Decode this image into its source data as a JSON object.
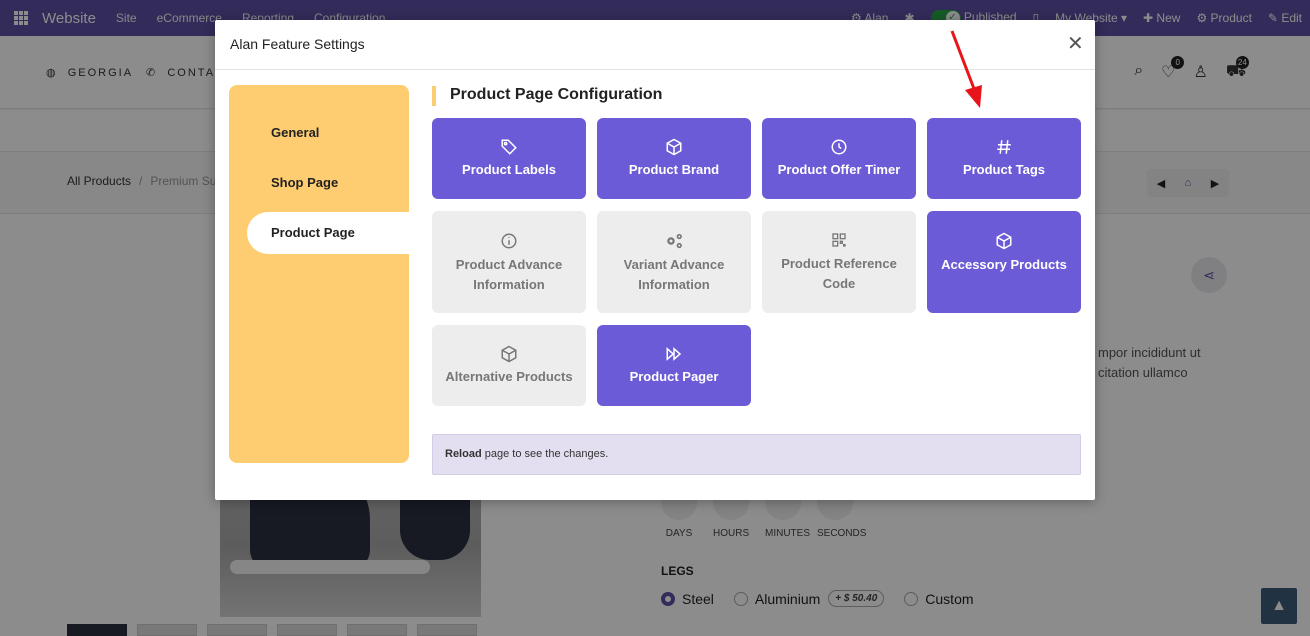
{
  "topbar": {
    "brand": "Website",
    "menus": [
      "Site",
      "eCommerce",
      "Reporting",
      "Configuration"
    ],
    "user": "Alan",
    "published": "Published",
    "website": "My Website",
    "new": "New",
    "product": "Product",
    "edit": "Edit"
  },
  "site": {
    "location": "GEORGIA",
    "contact": "CONTAC",
    "wishlist_count": "0",
    "cart_count": "24",
    "breadcrumb_root": "All Products",
    "breadcrumb_current": "Premium Su",
    "description_line1": "mpor incididunt ut",
    "description_line2": "citation ullamco",
    "timer": [
      {
        "label": "DAYS"
      },
      {
        "label": "HOURS"
      },
      {
        "label": "MINUTES"
      },
      {
        "label": "SECONDS"
      }
    ],
    "attribute_name": "LEGS",
    "options": [
      {
        "label": "Steel",
        "selected": true
      },
      {
        "label": "Aluminium",
        "price": "$ 50.40"
      },
      {
        "label": "Custom"
      }
    ]
  },
  "modal": {
    "title": "Alan Feature Settings",
    "sidebar": [
      {
        "label": "General"
      },
      {
        "label": "Shop Page"
      },
      {
        "label": "Product Page",
        "active": true
      }
    ],
    "section_title": "Product Page Configuration",
    "tiles": [
      {
        "label": "Product Labels",
        "icon": "tag-icon",
        "enabled": true
      },
      {
        "label": "Product Brand",
        "icon": "cube-icon",
        "enabled": true
      },
      {
        "label": "Product Offer Timer",
        "icon": "clock-icon",
        "enabled": true
      },
      {
        "label": "Product Tags",
        "icon": "hash-icon",
        "enabled": true
      },
      {
        "label": "Product Advance Information",
        "icon": "info-icon",
        "enabled": false
      },
      {
        "label": "Variant Advance Information",
        "icon": "gears-icon",
        "enabled": false
      },
      {
        "label": "Product Reference Code",
        "icon": "qrcode-icon",
        "enabled": false
      },
      {
        "label": "Accessory Products",
        "icon": "cube-icon",
        "enabled": true
      },
      {
        "label": "Alternative Products",
        "icon": "cube-icon",
        "enabled": false
      },
      {
        "label": "Product Pager",
        "icon": "fast-forward-icon",
        "enabled": true
      }
    ],
    "note_bold": "Reload",
    "note_text": " page to see the changes."
  },
  "colors": {
    "brand": "#5e4fa2",
    "tile_on": "#6b5bd6",
    "tile_off": "#ededed",
    "sidebar": "#fecd71",
    "arrow": "#e8141b"
  }
}
